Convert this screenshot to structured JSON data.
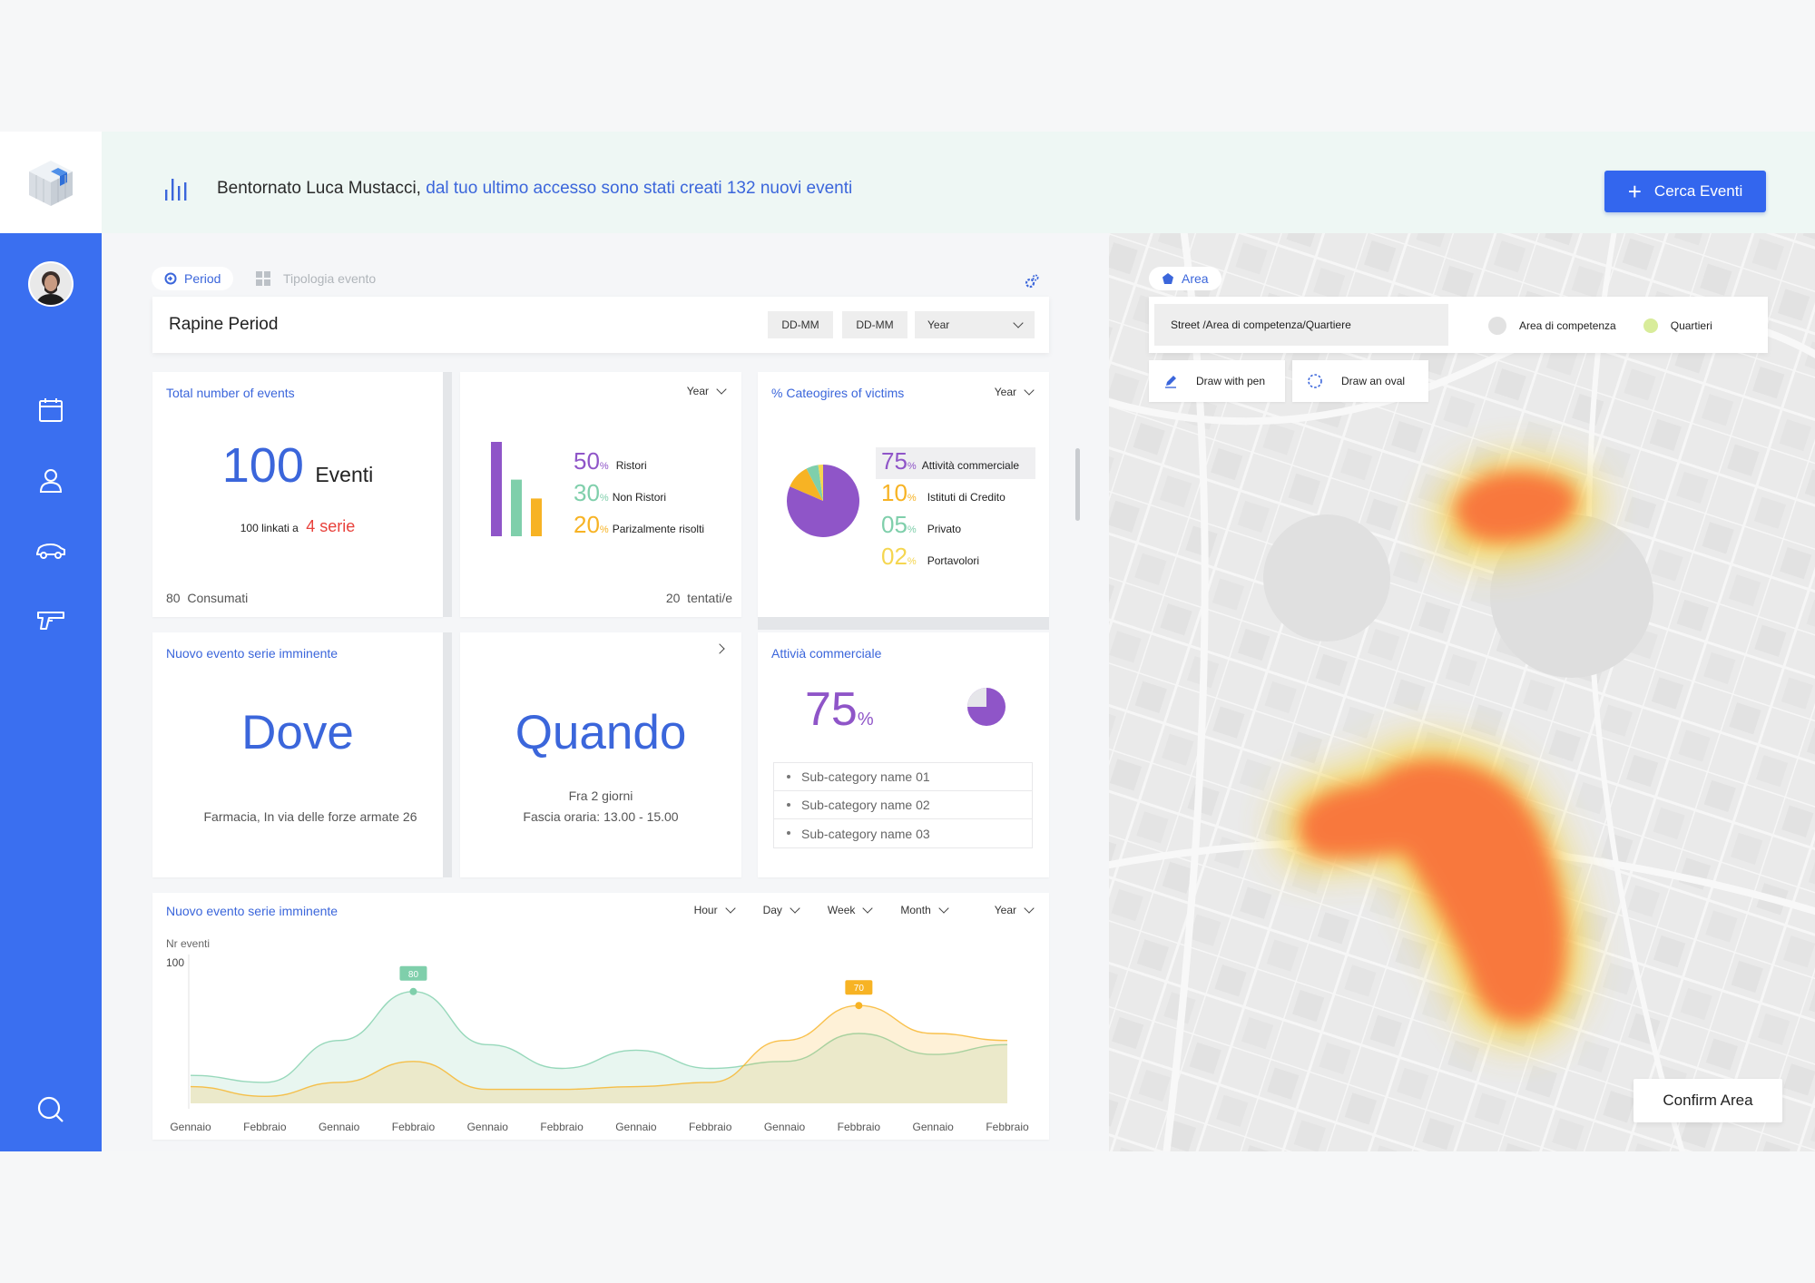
{
  "window": {
    "minimize": "–",
    "maximize": "▭",
    "close": "×"
  },
  "header": {
    "greeting_name": "Bentornato Luca Mustacci,",
    "greeting_message": "dal tuo ultimo accesso sono stati creati 132 nuovi eventi",
    "search_button": "Cerca Eventi"
  },
  "sidebar": {
    "items": [
      {
        "icon": "calendar-icon"
      },
      {
        "icon": "user-icon"
      },
      {
        "icon": "car-icon"
      },
      {
        "icon": "gun-icon"
      }
    ],
    "bottom_icon": "search-icon"
  },
  "filters": {
    "tabs": [
      "Period",
      "Tipologia evento"
    ],
    "title": "Rapine Period",
    "date_from": "DD-MM",
    "date_to": "DD-MM",
    "year_select": "Year"
  },
  "total_events": {
    "title": "Total number of events",
    "count": "100",
    "count_label": "Eventi",
    "linked_text": "100 linkati a",
    "series": "4 serie",
    "consumed": "80  Consumati"
  },
  "outcome_card": {
    "period": "Year",
    "rows": [
      {
        "pct": "50",
        "unit": "%",
        "label": "Ristori",
        "color": "#8f55c8"
      },
      {
        "pct": "30",
        "unit": "%",
        "label": "Non Ristori",
        "color": "#7fcfab"
      },
      {
        "pct": "20",
        "unit": "%",
        "label": "Parizalmente risolti",
        "color": "#f7b324"
      }
    ],
    "bars": [
      {
        "value": 50,
        "color": "#8f55c8"
      },
      {
        "value": 30,
        "color": "#7fcfab"
      },
      {
        "value": 20,
        "color": "#f7b324"
      }
    ],
    "attempted": "20  tentati/e"
  },
  "victims_card": {
    "title": "% Cateogires of victims",
    "period": "Year",
    "rows": [
      {
        "pct": "75",
        "unit": "%",
        "label": "Attività commerciale",
        "color": "#8f55c8"
      },
      {
        "pct": "10",
        "unit": "%",
        "label": "Istituti di Credito",
        "color": "#f7b324"
      },
      {
        "pct": "05",
        "unit": "%",
        "label": "Privato",
        "color": "#7fcfab"
      },
      {
        "pct": "02",
        "unit": "%",
        "label": "Portavolori",
        "color": "#f5d650"
      }
    ],
    "pie": [
      {
        "value": 75,
        "color": "#8f55c8"
      },
      {
        "value": 10,
        "color": "#f7b324"
      },
      {
        "value": 5,
        "color": "#7fcfab"
      },
      {
        "value": 2,
        "color": "#f5d650"
      }
    ]
  },
  "dove_card": {
    "title": "Nuovo evento serie imminente",
    "headline": "Dove",
    "detail": "Farmacia, In via delle forze armate 26"
  },
  "quando_card": {
    "headline": "Quando",
    "detail_1": "Fra 2 giorni",
    "detail_2": "Fascia oraria: 13.00 - 15.00"
  },
  "commercial_card": {
    "title": "Attivià commerciale",
    "pct": "75",
    "unit": "%",
    "subcategories": [
      "Sub-category name 01",
      "Sub-category name 02",
      "Sub-category name 03"
    ]
  },
  "timeline": {
    "title": "Nuovo evento serie imminente",
    "filters": [
      "Hour",
      "Day",
      "Week",
      "Month",
      "Year"
    ],
    "ylabel": "Nr eventi",
    "ymax_label": "100",
    "x_labels": [
      "Gennaio",
      "Febbraio",
      "Gennaio",
      "Febbraio",
      "Gennaio",
      "Febbraio",
      "Gennaio",
      "Febbraio",
      "Gennaio",
      "Febbraio",
      "Gennaio",
      "Febbraio"
    ]
  },
  "chart_data": {
    "type": "area",
    "xlabel": "",
    "ylabel": "Nr eventi",
    "ylim": [
      0,
      100
    ],
    "categories": [
      "Gennaio",
      "Febbraio",
      "Gennaio",
      "Febbraio",
      "Gennaio",
      "Febbraio",
      "Gennaio",
      "Febbraio",
      "Gennaio",
      "Febbraio",
      "Gennaio",
      "Febbraio"
    ],
    "series": [
      {
        "color": "#7fcfab",
        "values": [
          20,
          15,
          45,
          80,
          42,
          25,
          38,
          25,
          30,
          50,
          35,
          42
        ],
        "peak_label": "80",
        "peak_index": 3
      },
      {
        "color": "#f7b324",
        "values": [
          12,
          5,
          15,
          30,
          10,
          10,
          12,
          15,
          45,
          70,
          50,
          45
        ],
        "peak_label": "70",
        "peak_index": 9
      }
    ]
  },
  "map": {
    "area_label": "Area",
    "area_input": "Street /Area di competenza/Quartiere",
    "legend": [
      {
        "label": "Area di competenza",
        "color": "#dddddd"
      },
      {
        "label": "Quartieri",
        "color": "#d8ec9a"
      }
    ],
    "draw_pen": "Draw with pen",
    "draw_oval": "Draw an oval",
    "confirm": "Confirm Area"
  }
}
